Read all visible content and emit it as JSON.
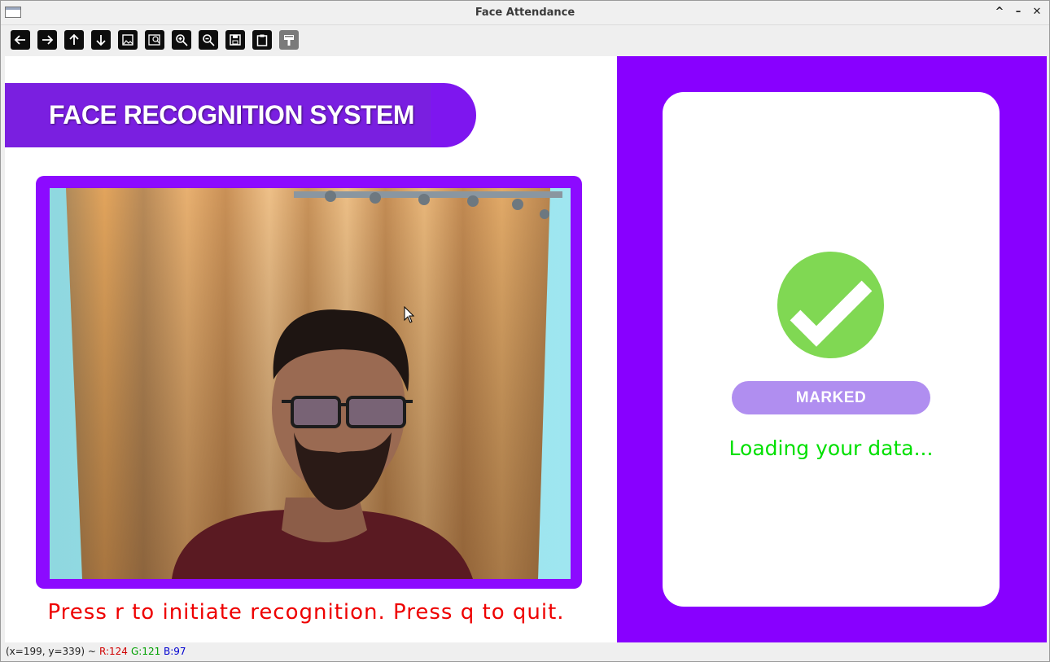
{
  "window": {
    "title": "Face Attendance"
  },
  "toolbar": {
    "buttons": [
      {
        "name": "back-icon"
      },
      {
        "name": "forward-icon"
      },
      {
        "name": "up-icon"
      },
      {
        "name": "down-icon"
      },
      {
        "name": "image-icon"
      },
      {
        "name": "image-zoom-icon"
      },
      {
        "name": "zoom-in-icon"
      },
      {
        "name": "zoom-out-icon"
      },
      {
        "name": "save-icon"
      },
      {
        "name": "clipboard-icon"
      },
      {
        "name": "properties-icon"
      }
    ]
  },
  "main": {
    "banner_title": "FACE RECOGNITION SYSTEM",
    "hint": "Press r to initiate recognition. Press q to quit."
  },
  "status_panel": {
    "badge": "MARKED",
    "message": "Loading your data..."
  },
  "statusbar": {
    "coords": "(x=199, y=339) ~ ",
    "r": "R:124",
    "g": "G:121",
    "b": "B:97"
  },
  "colors": {
    "accent": "#8800ff",
    "check": "#80d853",
    "badge": "#b08ef0",
    "message": "#00e000",
    "hint": "#ee0000"
  }
}
